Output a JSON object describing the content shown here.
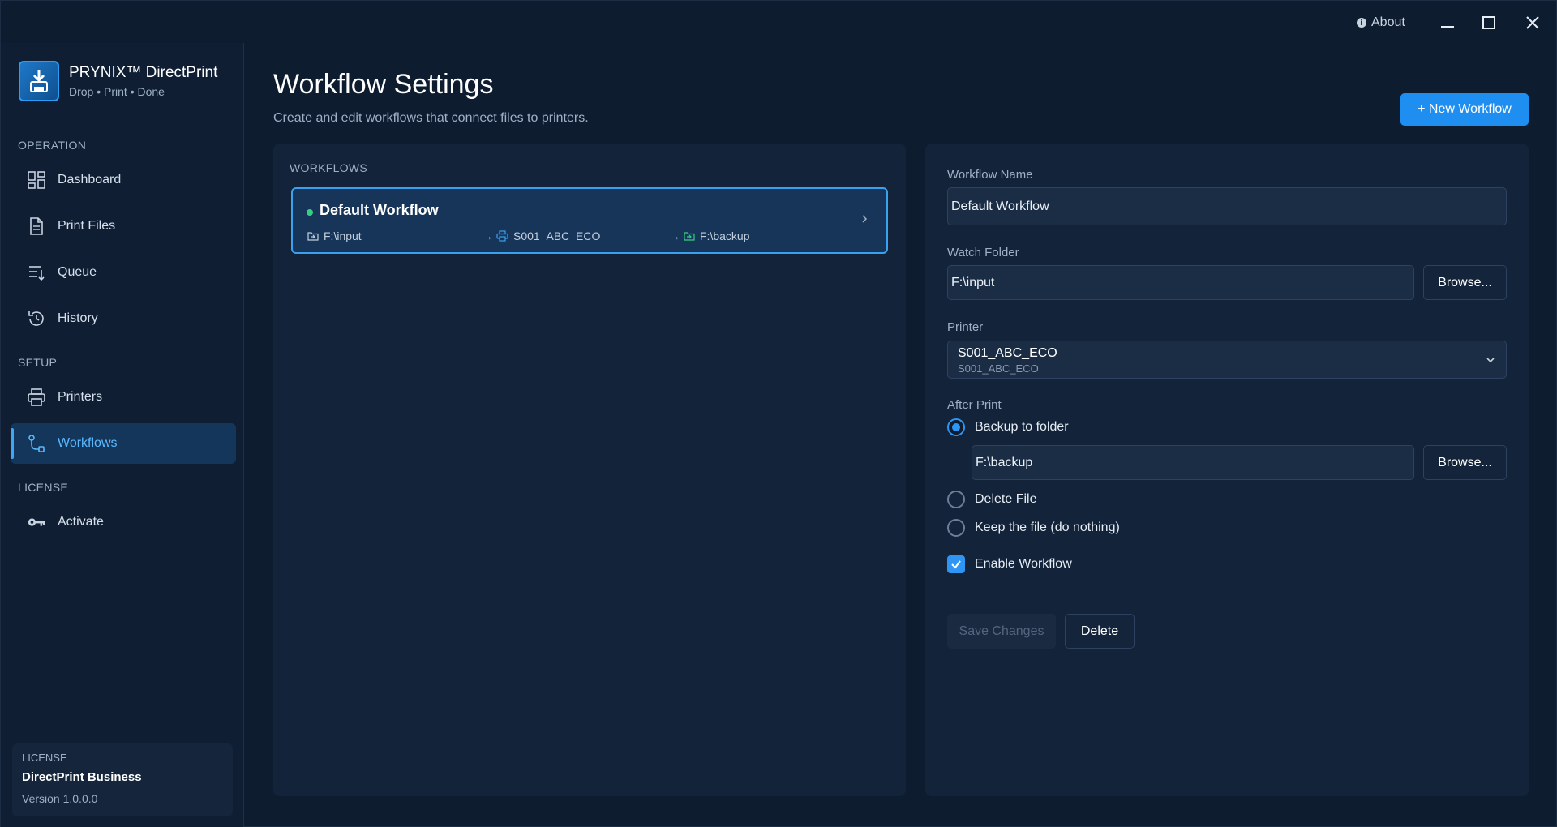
{
  "titlebar": {
    "about_label": "About",
    "minimize": "minimize",
    "maximize": "maximize",
    "close": "close"
  },
  "brand": {
    "title": "PRYNIX™ DirectPrint",
    "tagline": "Drop • Print • Done"
  },
  "sidebar": {
    "sections": {
      "operation": "OPERATION",
      "setup": "SETUP",
      "license": "LICENSE"
    },
    "items": [
      {
        "label": "Dashboard",
        "icon": "dashboard-icon"
      },
      {
        "label": "Print Files",
        "icon": "document-icon"
      },
      {
        "label": "Queue",
        "icon": "queue-icon"
      },
      {
        "label": "History",
        "icon": "history-icon"
      },
      {
        "label": "Printers",
        "icon": "printer-icon"
      },
      {
        "label": "Workflows",
        "icon": "workflow-icon",
        "active": true
      },
      {
        "label": "Activate",
        "icon": "key-icon"
      }
    ],
    "license_card": {
      "heading": "LICENSE",
      "product": "DirectPrint Business",
      "version": "Version 1.0.0.0"
    }
  },
  "page": {
    "title": "Workflow Settings",
    "subtitle": "Create and edit workflows that connect files to printers.",
    "new_button": "+ New Workflow"
  },
  "workflows": {
    "heading": "WORKFLOWS",
    "list": [
      {
        "name": "Default Workflow",
        "status_color": "#35d07f",
        "input": "F:\\input",
        "printer": "S001_ABC_ECO",
        "backup": "F:\\backup"
      }
    ]
  },
  "editor": {
    "name_label": "Workflow Name",
    "name_value": "Default Workflow",
    "watch_label": "Watch Folder",
    "watch_value": "F:\\input",
    "browse_label": "Browse...",
    "printer_label": "Printer",
    "printer_name": "S001_ABC_ECO",
    "printer_sub": "S001_ABC_ECO",
    "after_print_label": "After Print",
    "options": {
      "backup": "Backup to folder",
      "delete": "Delete File",
      "keep": "Keep the file (do nothing)"
    },
    "backup_path": "F:\\backup",
    "enable_label": "Enable Workflow",
    "save_label": "Save Changes",
    "delete_label": "Delete"
  },
  "colors": {
    "accent": "#1f8ef1",
    "background": "#0e1c30",
    "panel": "#13233a",
    "active_nav": "#14365b"
  }
}
